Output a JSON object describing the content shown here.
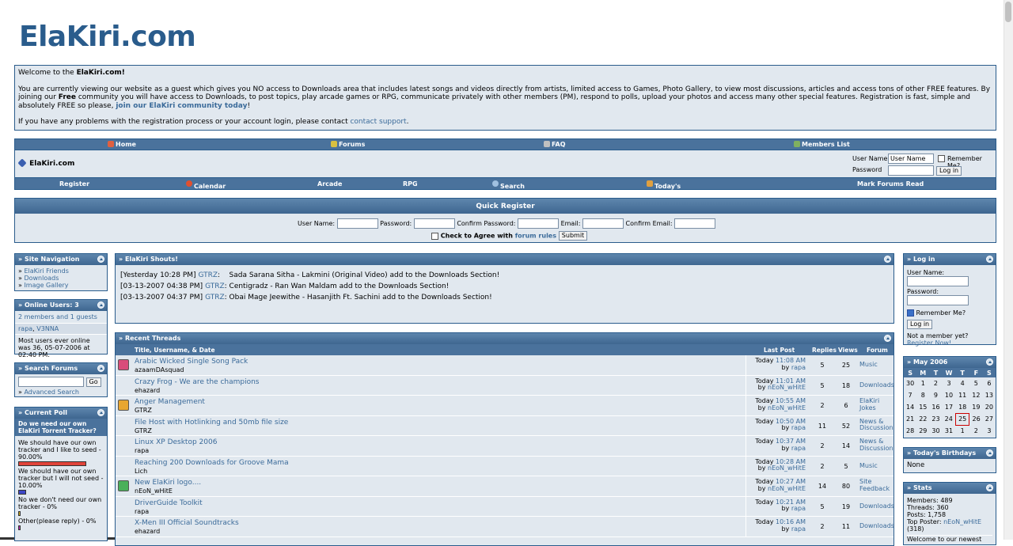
{
  "site": {
    "logo": "ElaKiri.com"
  },
  "welcome": {
    "greeting_prefix": "Welcome to the ",
    "greeting_bold": "ElaKiri.com!",
    "para1_a": "You are currently viewing our website as a guest which gives you NO access to Downloads area that includes latest songs and videos directly from artists, limited access to Games, Photo Gallery, to view most discussions, articles and access tons of other FREE features. By joining our ",
    "para1_bold": "Free",
    "para1_b": " community you will have access to Downloads, to post topics, play arcade games or RPG, communicate privately with other members (PM), respond to polls, upload your photos and access many other special features. Registration is fast, simple and absolutely FREE so please, ",
    "join_link": "join our ElaKiri community today",
    "para1_c": "!",
    "para2_a": "If you have any problems with the registration process or your account login, please contact ",
    "contact_link": "contact support",
    "para2_b": "."
  },
  "nav": {
    "top": [
      "Home",
      "Forums",
      "FAQ",
      "Members List"
    ],
    "site_name": "ElaKiri.com",
    "user_name_label": "User Name",
    "user_name_value": "User Name",
    "remember_label": "Remember Me?",
    "password_label": "Password",
    "login_button": "Log in",
    "bottom": [
      "Register",
      "Calendar",
      "Arcade",
      "RPG",
      "Search",
      "Today's Posts",
      "Mark Forums Read"
    ]
  },
  "quick_register": {
    "title": "Quick Register",
    "user_name": "User Name:",
    "password": "Password:",
    "confirm_password": "Confirm Password:",
    "email": "Email:",
    "confirm_email": "Confirm Email:",
    "agree_prefix": "Check to Agree with ",
    "forum_rules": "forum rules",
    "submit": "Submit"
  },
  "site_nav": {
    "title": "» Site Navigation",
    "items": [
      "ElaKiri Friends",
      "Downloads",
      "Image Gallery"
    ]
  },
  "online": {
    "title": "» Online Users: 3",
    "summary": "2 members and 1 guests",
    "user1": "rapa",
    "user2": "V3NNA",
    "record": "Most users ever online was 36, 05-07-2006 at 02:40 PM."
  },
  "search_forums": {
    "title": "» Search Forums",
    "go": "Go",
    "advanced": "Advanced Search"
  },
  "poll": {
    "title": "» Current Poll",
    "question": "Do we need our own ElaKiri Torrent Tracker?",
    "options": [
      {
        "text": "We should have our own tracker and I like to seed - 90.00%",
        "percent": 90,
        "color": "#e0443a"
      },
      {
        "text": "We should have our own tracker but I will not seed - 10.00%",
        "percent": 10,
        "color": "#3e48c8"
      },
      {
        "text": "No we don't need our own tracker - 0%",
        "percent": 0,
        "color": "#d8b820"
      },
      {
        "text": "Other(please reply) - 0%",
        "percent": 0,
        "color": "#c030c0"
      }
    ]
  },
  "shouts": {
    "title": "» ElaKiri Shouts!",
    "items": [
      {
        "time": "[Yesterday 10:28 PM]",
        "user": "GTRZ",
        "text": ":    Sada Sarana Sitha - Lakmini (Original Video) add to the Downloads Section!"
      },
      {
        "time": "[03-13-2007 04:38 PM]",
        "user": "GTRZ",
        "text": ": Centigradz - Ran Wan Maldam add to the Downloads Section!"
      },
      {
        "time": "[03-13-2007 04:37 PM]",
        "user": "GTRZ",
        "text": ": Obai Mage Jeewithe - Hasanjith Ft. Sachini add to the Downloads Section!"
      }
    ]
  },
  "recent_threads": {
    "title": "» Recent Threads",
    "col_title": "Title, Username, & Date",
    "col_last": "Last Post",
    "col_replies": "Replies",
    "col_views": "Views",
    "col_forum": "Forum",
    "rows": [
      {
        "title": "Arabic Wicked Single Song Pack",
        "user": "azaamDAsquad",
        "day": "Today",
        "time": "11:08 AM",
        "by": "rapa",
        "replies": "5",
        "views": "25",
        "forum": "Music",
        "icon": "#d94c7a"
      },
      {
        "title": "Crazy Frog - We are the champions",
        "user": "ehazard",
        "day": "Today",
        "time": "11:01 AM",
        "by": "nEoN_wHitE",
        "replies": "5",
        "views": "18",
        "forum": "Downloads",
        "icon": ""
      },
      {
        "title": "Anger Management",
        "user": "GTRZ",
        "day": "Today",
        "time": "10:55 AM",
        "by": "nEoN_wHitE",
        "replies": "2",
        "views": "6",
        "forum": "ElaKiri Jokes",
        "icon": "#e8a630"
      },
      {
        "title": "File Host with Hotlinking and 50mb file size",
        "user": "GTRZ",
        "day": "Today",
        "time": "10:50 AM",
        "by": "rapa",
        "replies": "11",
        "views": "52",
        "forum": "News & Discussion",
        "icon": ""
      },
      {
        "title": "Linux XP Desktop 2006",
        "user": "rapa",
        "day": "Today",
        "time": "10:37 AM",
        "by": "rapa",
        "replies": "2",
        "views": "14",
        "forum": "News & Discussion",
        "icon": ""
      },
      {
        "title": "Reaching 200 Downloads for Groove Mama",
        "user": "Lich",
        "day": "Today",
        "time": "10:28 AM",
        "by": "nEoN_wHitE",
        "replies": "2",
        "views": "5",
        "forum": "Music",
        "icon": ""
      },
      {
        "title": "New ElaKiri logo....",
        "user": "nEoN_wHitE",
        "day": "Today",
        "time": "10:27 AM",
        "by": "nEoN_wHitE",
        "replies": "14",
        "views": "80",
        "forum": "Site Feedback",
        "icon": "#4ab05a"
      },
      {
        "title": "DriverGuide Toolkit",
        "user": "rapa",
        "day": "Today",
        "time": "10:21 AM",
        "by": "rapa",
        "replies": "5",
        "views": "19",
        "forum": "Downloads",
        "icon": ""
      },
      {
        "title": "X-Men III Official Soundtracks",
        "user": "ehazard",
        "day": "Today",
        "time": "10:16 AM",
        "by": "rapa",
        "replies": "2",
        "views": "11",
        "forum": "Downloads",
        "icon": ""
      }
    ],
    "by_prefix": "by "
  },
  "login": {
    "title": "» Log in",
    "user_name": "User Name:",
    "password": "Password:",
    "remember": "Remember Me?",
    "button": "Log in",
    "not_member": "Not a member yet?",
    "register": "Register Now!"
  },
  "calendar": {
    "title": "» May 2006",
    "days": [
      "S",
      "M",
      "T",
      "W",
      "T",
      "F",
      "S"
    ],
    "weeks": [
      [
        "30",
        "1",
        "2",
        "3",
        "4",
        "5",
        "6"
      ],
      [
        "7",
        "8",
        "9",
        "10",
        "11",
        "12",
        "13"
      ],
      [
        "14",
        "15",
        "16",
        "17",
        "18",
        "19",
        "20"
      ],
      [
        "21",
        "22",
        "23",
        "24",
        "25",
        "26",
        "27"
      ],
      [
        "28",
        "29",
        "30",
        "31",
        "1",
        "2",
        "3"
      ]
    ],
    "today": "25"
  },
  "birthdays": {
    "title": "» Today's Birthdays",
    "value": "None"
  },
  "stats": {
    "title": "» Stats",
    "members": "Members: 489",
    "threads": "Threads: 360",
    "posts": "Posts: 1,758",
    "top_poster_label": "Top Poster: ",
    "top_poster": "nEoN_wHitE",
    "top_poster_count": "(318)",
    "welcome_cut": "Welcome to our newest"
  }
}
